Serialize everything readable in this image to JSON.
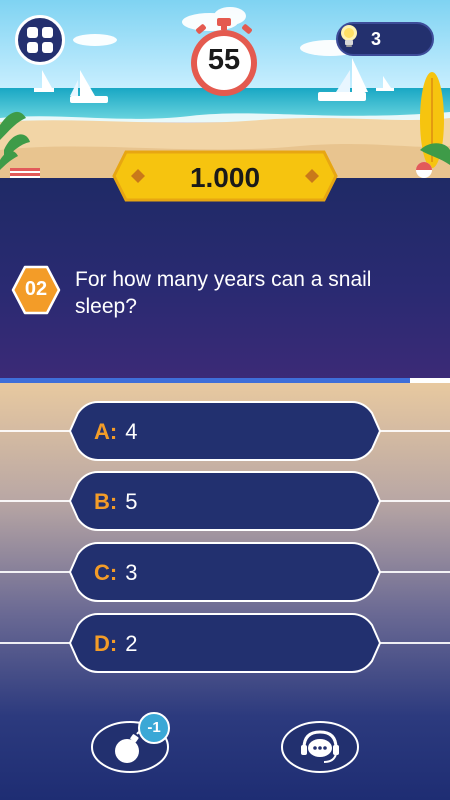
{
  "header": {
    "timer": "55",
    "hints_count": "3"
  },
  "score": {
    "value": "1.000"
  },
  "question": {
    "number": "02",
    "text": "For how many years can a snail sleep?",
    "progress_fraction": 0.91
  },
  "answers": [
    {
      "letter": "A:",
      "text": "4"
    },
    {
      "letter": "B:",
      "text": "5"
    },
    {
      "letter": "C:",
      "text": "3"
    },
    {
      "letter": "D:",
      "text": "2"
    }
  ],
  "lifelines": {
    "bomb_badge": "-1"
  },
  "colors": {
    "accent_orange": "#f39c28",
    "score_yellow": "#f6c40f",
    "answer_blue": "#22306f",
    "timer_red": "#e45a4f"
  },
  "icons": [
    "menu-grid-icon",
    "stopwatch-icon",
    "lightbulb-icon",
    "bomb-icon",
    "audience-chat-icon"
  ]
}
